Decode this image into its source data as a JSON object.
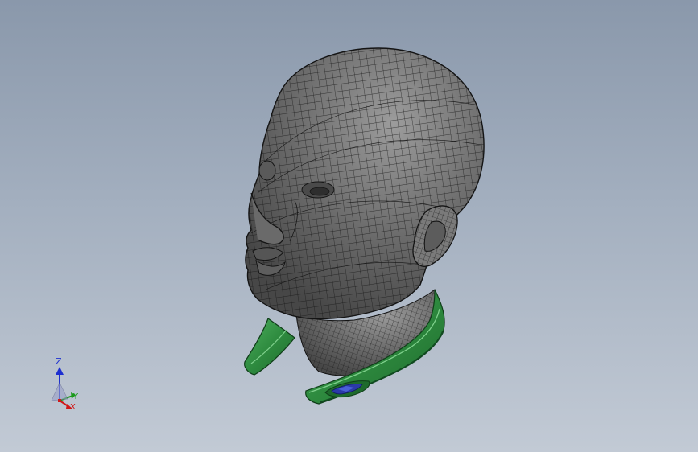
{
  "view": {
    "background_top": "#8a98ab",
    "background_bottom": "#c2cad5"
  },
  "model": {
    "mesh_fill": "#6e6e6e",
    "mesh_line": "#141414",
    "collar_color": "#2e8b3f",
    "collar_dark": "#1f6a2d",
    "collar_light": "#4fb060",
    "lens_color": "#2b3aa8"
  },
  "triad": {
    "z_label": "Z",
    "y_label": "Y",
    "x_label": "X",
    "z_color": "#1d2fd0",
    "y_color": "#1a9a1a",
    "x_color": "#d01818"
  }
}
